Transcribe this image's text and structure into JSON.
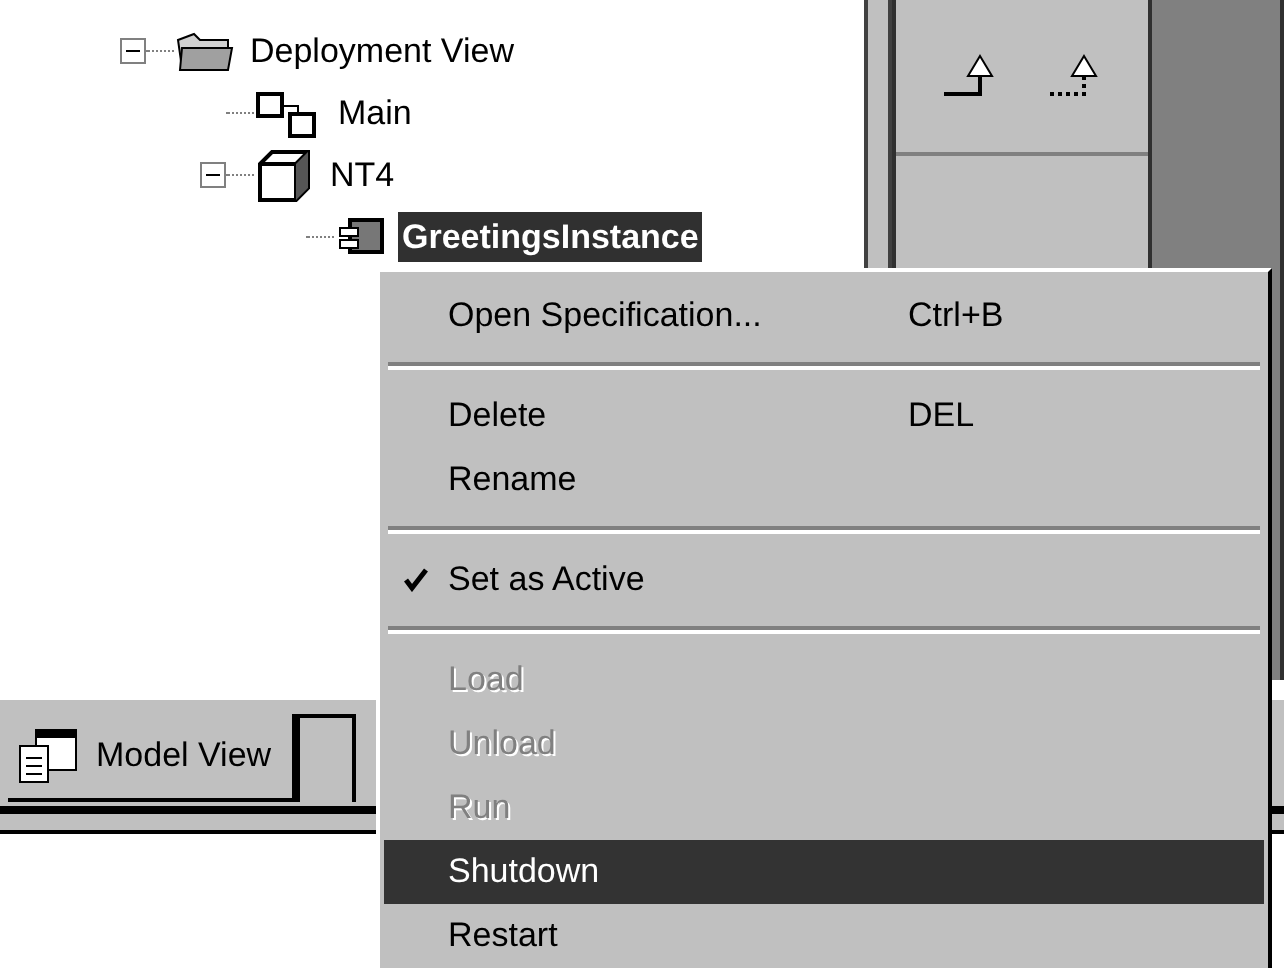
{
  "tree": [
    {
      "label": "Deployment View",
      "kind": "folder",
      "expanded": true,
      "selected": false,
      "children": [
        {
          "label": "Main",
          "kind": "diagram",
          "selected": false
        },
        {
          "label": "NT4",
          "kind": "node",
          "expanded": true,
          "selected": false,
          "children": [
            {
              "label": "GreetingsInstance",
              "kind": "component",
              "selected": true
            }
          ]
        }
      ]
    }
  ],
  "tabs": [
    {
      "label": "Model View",
      "selected": true
    }
  ],
  "context_menu": [
    {
      "kind": "item",
      "label": "Open Specification...",
      "shortcut": "Ctrl+B",
      "disabled": false,
      "checked": false,
      "selected": false
    },
    {
      "kind": "separator"
    },
    {
      "kind": "item",
      "label": "Delete",
      "shortcut": "DEL",
      "disabled": false,
      "checked": false,
      "selected": false
    },
    {
      "kind": "item",
      "label": "Rename",
      "disabled": false,
      "checked": false,
      "selected": false
    },
    {
      "kind": "separator"
    },
    {
      "kind": "item",
      "label": "Set as Active",
      "disabled": false,
      "checked": true,
      "selected": false
    },
    {
      "kind": "separator"
    },
    {
      "kind": "item",
      "label": "Load",
      "disabled": true,
      "checked": false,
      "selected": false
    },
    {
      "kind": "item",
      "label": "Unload",
      "disabled": true,
      "checked": false,
      "selected": false
    },
    {
      "kind": "item",
      "label": "Run",
      "disabled": true,
      "checked": false,
      "selected": false
    },
    {
      "kind": "item",
      "label": "Shutdown",
      "disabled": false,
      "checked": false,
      "selected": true
    },
    {
      "kind": "item",
      "label": "Restart",
      "disabled": false,
      "checked": false,
      "selected": false
    }
  ]
}
